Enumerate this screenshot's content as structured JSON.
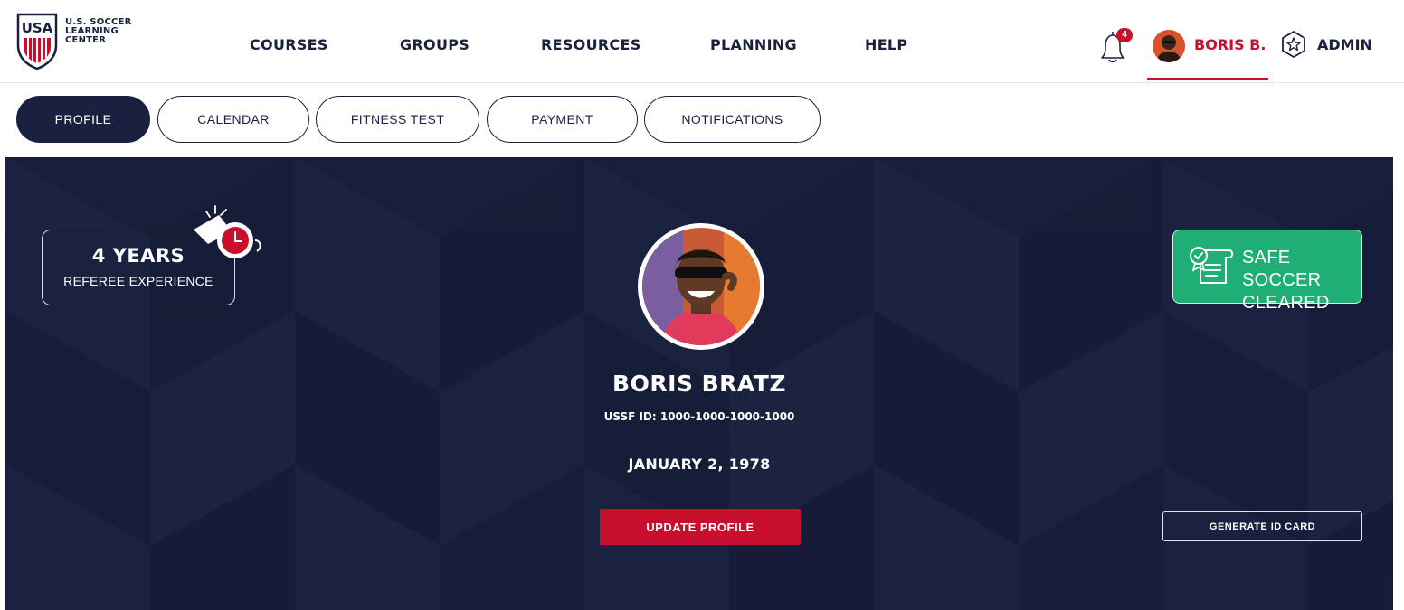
{
  "brand": {
    "shield_text": "USA",
    "lines": [
      "U.S. SOCCER",
      "LEARNING",
      "CENTER"
    ]
  },
  "nav": {
    "items": [
      {
        "label": "COURSES"
      },
      {
        "label": "GROUPS"
      },
      {
        "label": "RESOURCES"
      },
      {
        "label": "PLANNING"
      },
      {
        "label": "HELP"
      }
    ]
  },
  "notifications": {
    "count": "4",
    "icon": "bell-icon"
  },
  "user": {
    "name": "BORIS B.",
    "icon": "avatar"
  },
  "admin": {
    "label": "ADMIN",
    "icon": "star-badge-icon"
  },
  "tabs": [
    {
      "label": "PROFILE",
      "active": true
    },
    {
      "label": "CALENDAR",
      "active": false
    },
    {
      "label": "FITNESS TEST",
      "active": false
    },
    {
      "label": "PAYMENT",
      "active": false
    },
    {
      "label": "NOTIFICATIONS",
      "active": false
    }
  ],
  "profile": {
    "experience_years": "4 YEARS",
    "experience_label": "REFEREE EXPERIENCE",
    "safe_soccer": [
      "SAFE SOCCER",
      "CLEARED"
    ],
    "name": "BORIS BRATZ",
    "ussf_id": "USSF ID: 1000-1000-1000-1000",
    "dob": "JANUARY 2, 1978",
    "update_label": "UPDATE PROFILE",
    "generate_label": "GENERATE ID CARD"
  },
  "colors": {
    "navy": "#1a2040",
    "red": "#c8102e",
    "green": "#1fae74",
    "hero_bg": "#181f3b"
  }
}
